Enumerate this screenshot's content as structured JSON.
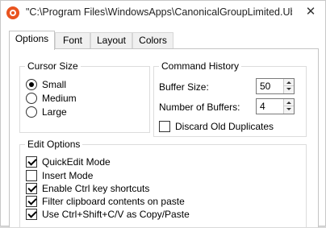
{
  "window": {
    "title": "\"C:\\Program Files\\WindowsApps\\CanonicalGroupLimited.Ub...",
    "close_glyph": "✕",
    "icon": "ubuntu-logo-icon",
    "accent_color": "#e95420"
  },
  "tabs": [
    {
      "label": "Options",
      "active": true
    },
    {
      "label": "Font",
      "active": false
    },
    {
      "label": "Layout",
      "active": false
    },
    {
      "label": "Colors",
      "active": false
    }
  ],
  "cursor_size": {
    "title": "Cursor Size",
    "options": [
      {
        "label": "Small",
        "selected": true
      },
      {
        "label": "Medium",
        "selected": false
      },
      {
        "label": "Large",
        "selected": false
      }
    ]
  },
  "command_history": {
    "title": "Command History",
    "buffer_size": {
      "label": "Buffer Size:",
      "value": "50"
    },
    "number_of_buffers": {
      "label": "Number of Buffers:",
      "value": "4"
    },
    "discard_old_duplicates": {
      "label": "Discard Old Duplicates",
      "checked": false
    }
  },
  "edit_options": {
    "title": "Edit Options",
    "items": [
      {
        "label": "QuickEdit Mode",
        "checked": true
      },
      {
        "label": "Insert Mode",
        "checked": false
      },
      {
        "label": "Enable Ctrl key shortcuts",
        "checked": true
      },
      {
        "label": "Filter clipboard contents on paste",
        "checked": true
      },
      {
        "label": "Use Ctrl+Shift+C/V as Copy/Paste",
        "checked": true
      }
    ]
  }
}
